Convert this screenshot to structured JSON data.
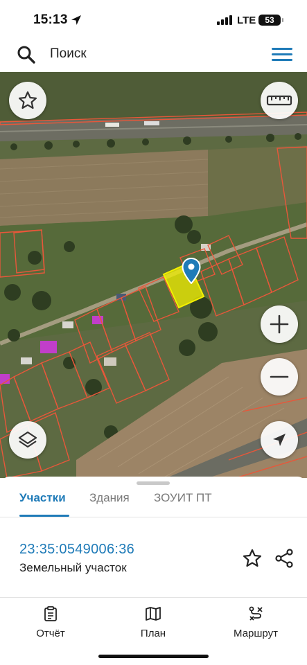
{
  "status_bar": {
    "time": "15:13",
    "network": "LTE",
    "battery": "53"
  },
  "search": {
    "label": "Поиск"
  },
  "map": {
    "description_icons": [
      "star-icon",
      "ruler-icon",
      "plus-icon",
      "minus-icon",
      "layers-icon",
      "navigation-arrow-icon",
      "map-pin-icon"
    ],
    "parcel_border_color": "#e8573a",
    "selected_parcel_color": "#f3f000"
  },
  "sheet": {
    "tabs": [
      {
        "label": "Участки",
        "active": true
      },
      {
        "label": "Здания",
        "active": false
      },
      {
        "label": "ЗОУИТ ПТ",
        "active": false
      }
    ],
    "parcel": {
      "cadastral_number": "23:35:0549006:36",
      "type": "Земельный участок"
    }
  },
  "bottom_nav": {
    "items": [
      {
        "label": "Отчёт",
        "icon": "report-icon"
      },
      {
        "label": "План",
        "icon": "map-plan-icon"
      },
      {
        "label": "Маршрут",
        "icon": "route-icon"
      }
    ]
  },
  "colors": {
    "accent": "#1f7bb8",
    "parcel_border": "#e8573a",
    "selected_parcel": "#f3f000"
  }
}
